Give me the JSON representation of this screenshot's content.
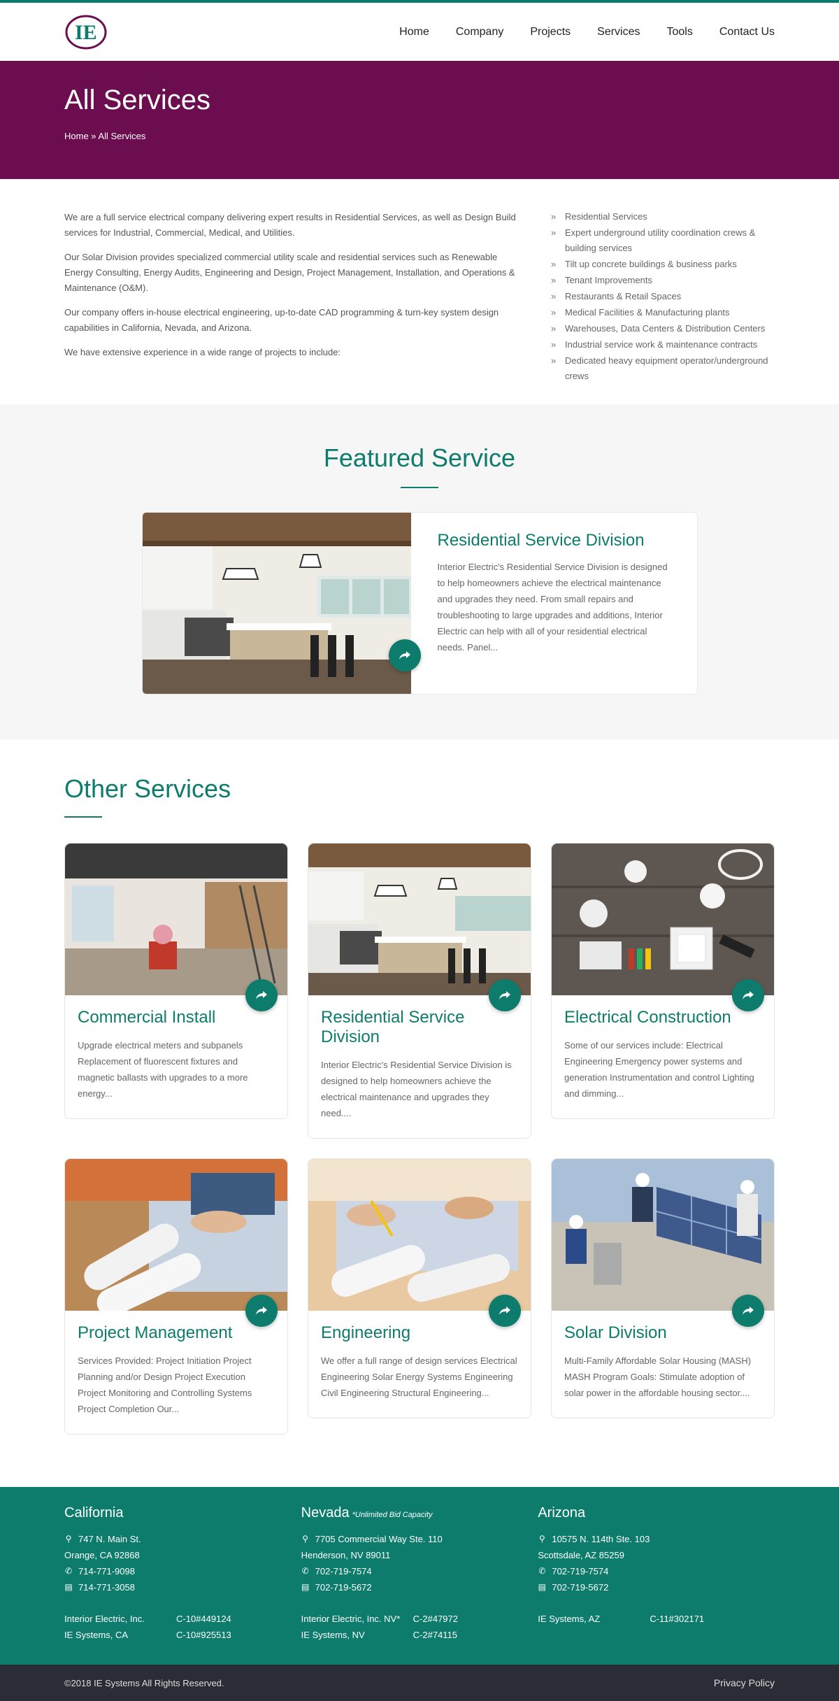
{
  "colors": {
    "accent": "#0e7c6c",
    "hero": "#6b0d4f",
    "footer_bottom": "#2b2d36"
  },
  "logo": {
    "text": "IE"
  },
  "nav": [
    "Home",
    "Company",
    "Projects",
    "Services",
    "Tools",
    "Contact Us"
  ],
  "hero": {
    "title": "All Services",
    "breadcrumb": "Home » All Services"
  },
  "intro": {
    "paragraphs": [
      "We are a full service electrical company delivering  expert results in Residential Services, as well as Design Build services for Industrial, Commercial,  Medical, and Utilities.",
      "Our Solar Division provides specialized commercial utility scale and residential services such as Renewable Energy Consulting, Energy  Audits, Engineering and Design, Project Management, Installation, and  Operations & Maintenance (O&M).",
      "Our company offers in-house electrical engineering, up-to-date CAD programming &  turn-key system design capabilities in California, Nevada, and Arizona.",
      "We have extensive experience in a wide range of projects to include:"
    ],
    "list": [
      "Residential Services",
      "Expert underground utility coordination crews & building services",
      "Tilt up concrete buildings & business parks",
      "Tenant Improvements",
      "Restaurants & Retail Spaces",
      "Medical Facilities & Manufacturing plants",
      "Warehouses, Data Centers & Distribution Centers",
      "Industrial service work & maintenance contracts",
      "Dedicated heavy equipment operator/underground crews"
    ]
  },
  "featured": {
    "heading": "Featured Service",
    "title": "Residential Service Division",
    "text": "Interior Electric's Residential Service Division is designed to help homeowners achieve the electrical maintenance and upgrades they need. From small repairs and troubleshooting to large upgrades and additions, Interior Electric can help with all of your residential electrical needs. Panel..."
  },
  "other": {
    "heading": "Other Services",
    "cards": [
      {
        "title": "Commercial Install",
        "text": "Upgrade electrical meters and subpanels Replacement of fluorescent fixtures and magnetic ballasts with upgrades to a more energy..."
      },
      {
        "title": "Residential Service Division",
        "text": "Interior Electric's Residential Service Division is designed to help homeowners achieve the electrical maintenance and upgrades they need...."
      },
      {
        "title": "Electrical Construction",
        "text": "Some of our services include: Electrical Engineering Emergency power systems and generation Instrumentation and control Lighting and dimming..."
      },
      {
        "title": "Project Management",
        "text": "Services Provided: Project Initiation Project Planning and/or Design Project Execution Project Monitoring and Controlling Systems Project Completion Our..."
      },
      {
        "title": "Engineering",
        "text": "We offer a full range of design services Electrical Engineering Solar Energy Systems Engineering Civil Engineering Structural Engineering..."
      },
      {
        "title": "Solar Division",
        "text": "Multi-Family Affordable Solar Housing (MASH) MASH Program Goals: Stimulate adoption of solar power in the affordable housing sector...."
      }
    ]
  },
  "footer": {
    "california": {
      "title": "California",
      "addr1": "747 N. Main St.",
      "addr2": "Orange, CA 92868",
      "phone": "714-771-9098",
      "fax": "714-771-3058",
      "lic1_name": "Interior Electric, Inc.",
      "lic1_num": "C-10#449124",
      "lic2_name": "IE Systems, CA",
      "lic2_num": "C-10#925513"
    },
    "nevada": {
      "title": "Nevada",
      "note": "*Unlimited Bid Capacity",
      "addr1": "7705 Commercial Way Ste. 110",
      "addr2": "Henderson, NV 89011",
      "phone": "702-719-7574",
      "fax": "702-719-5672",
      "lic1_name": "Interior Electric, Inc. NV*",
      "lic1_num": "C-2#47972",
      "lic2_name": "IE Systems, NV",
      "lic2_num": "C-2#74115"
    },
    "arizona": {
      "title": "Arizona",
      "addr1": "10575 N. 114th Ste. 103",
      "addr2": "Scottsdale, AZ 85259",
      "phone": "702-719-7574",
      "fax": "702-719-5672",
      "lic1_name": "IE Systems, AZ",
      "lic1_num": "C-11#302171"
    },
    "copyright": "©2018 IE Systems All Rights Reserved.",
    "privacy": "Privacy Policy"
  }
}
